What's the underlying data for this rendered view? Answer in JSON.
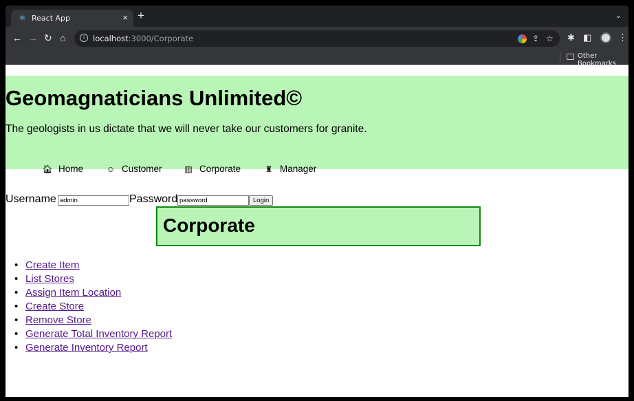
{
  "browser": {
    "tab_title": "React App",
    "tab_close": "×",
    "new_tab": "+",
    "tab_search": "⌄",
    "url_host": "localhost",
    "url_path": ":3000/Corporate",
    "bookmark_label": "Other Bookmarks"
  },
  "site": {
    "title": "Geomagnaticians Unlimited©",
    "tagline": "The geologists in us dictate that we will never take our customers for granite."
  },
  "nav": [
    {
      "label": "Home",
      "icon": "home-icon"
    },
    {
      "label": "Customer",
      "icon": "smiley-icon"
    },
    {
      "label": "Corporate",
      "icon": "building-icon"
    },
    {
      "label": "Manager",
      "icon": "manager-icon"
    }
  ],
  "login": {
    "username_label": "Username",
    "username_value": "admin",
    "password_label": "Password",
    "password_value": "password",
    "button_label": "Login"
  },
  "section": {
    "title": "Corporate"
  },
  "menu": [
    {
      "label": "Create Item"
    },
    {
      "label": "List Stores"
    },
    {
      "label": "Assign Item Location"
    },
    {
      "label": "Create Store"
    },
    {
      "label": "Remove Store"
    },
    {
      "label": "Generate Total Inventory Report"
    },
    {
      "label": "Generate Inventory Report"
    }
  ],
  "colors": {
    "header_bg": "#b9f5b6",
    "box_border": "#118a11",
    "link": "#551a8b"
  }
}
